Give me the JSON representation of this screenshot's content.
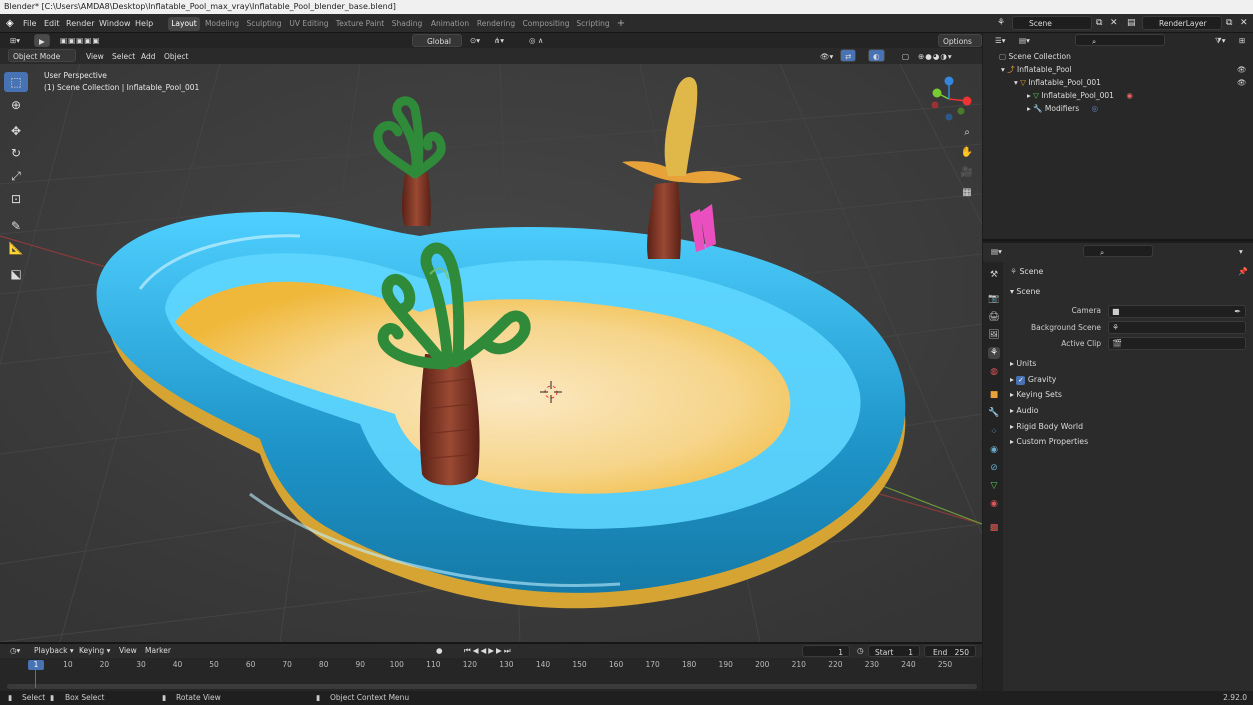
{
  "title_bar": "Blender* [C:\\Users\\AMDA8\\Desktop\\Inflatable_Pool_max_vray\\Inflatable_Pool_blender_base.blend]",
  "menus": [
    "File",
    "Edit",
    "Render",
    "Window",
    "Help"
  ],
  "workspaces": [
    "Layout",
    "Modeling",
    "Sculpting",
    "UV Editing",
    "Texture Paint",
    "Shading",
    "Animation",
    "Rendering",
    "Compositing",
    "Scripting"
  ],
  "active_workspace": "Layout",
  "scene_field": "Scene",
  "view_layer_field": "RenderLayer",
  "viewport": {
    "transform_orientation": "Global",
    "options_label": "Options",
    "mode": "Object Mode",
    "header_menus": [
      "View",
      "Select",
      "Add",
      "Object"
    ],
    "perspective_label": "User Perspective",
    "collection_label": "(1) Scene Collection | Inflatable_Pool_001",
    "gizmo_axes": [
      "X",
      "Y",
      "Z"
    ]
  },
  "outliner": {
    "rows": [
      {
        "label": "Scene Collection"
      },
      {
        "label": "Inflatable_Pool"
      },
      {
        "label": "Inflatable_Pool_001"
      },
      {
        "label": "Inflatable_Pool_001"
      },
      {
        "label": "Modifiers"
      }
    ]
  },
  "properties": {
    "context_label": "Scene",
    "panel_title": "Scene",
    "fields": [
      {
        "label": "Camera"
      },
      {
        "label": "Background Scene"
      },
      {
        "label": "Active Clip"
      }
    ],
    "panels": [
      "Units",
      "Gravity",
      "Keying Sets",
      "Audio",
      "Rigid Body World",
      "Custom Properties"
    ],
    "gravity_checked": true
  },
  "timeline": {
    "menus": [
      "Playback",
      "Keying",
      "View",
      "Marker"
    ],
    "current_frame": "1",
    "start_label": "Start",
    "start_value": "1",
    "end_label": "End",
    "end_value": "250",
    "ticks": [
      "1",
      "10",
      "20",
      "30",
      "40",
      "50",
      "60",
      "70",
      "80",
      "90",
      "100",
      "110",
      "120",
      "130",
      "140",
      "150",
      "160",
      "170",
      "180",
      "190",
      "200",
      "210",
      "220",
      "230",
      "240",
      "250"
    ]
  },
  "status_bar": {
    "items": [
      "Select",
      "Box Select",
      "Rotate View",
      "Object Context Menu"
    ],
    "version": "2.92.0"
  },
  "colors": {
    "accent": "#4772b3",
    "pool_blue": "#2aa8d8",
    "sand": "#f2c96a",
    "palm_green": "#2f8a3a",
    "trunk": "#7a3322"
  }
}
